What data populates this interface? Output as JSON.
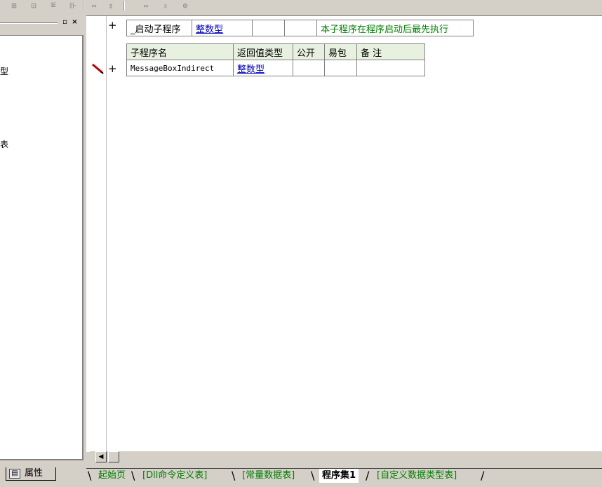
{
  "toolbar": {
    "icons": [
      "merge-cells-icon",
      "center-icon",
      "align-icon",
      "split-icon",
      "width-icon",
      "height-icon",
      "hspan-icon",
      "vspan-icon",
      "fit-icon"
    ]
  },
  "left_panel": {
    "tree_items": [
      "型",
      "表"
    ],
    "props_tab_label": "属性"
  },
  "editor": {
    "startup_row": {
      "name": "_启动子程序",
      "type": "整数型",
      "public": "",
      "easy": "",
      "comment": "本子程序在程序启动后最先执行"
    },
    "table_header": [
      "子程序名",
      "返回值类型",
      "公开",
      "易包",
      "备 注"
    ],
    "sub_row": {
      "name": "MessageBoxIndirect",
      "type": "整数型",
      "public": "",
      "easy": "",
      "comment": ""
    },
    "plus_symbol": "+"
  },
  "tabs": [
    {
      "label": "起始页",
      "active": false
    },
    {
      "label": "[Dll命令定义表]",
      "active": false
    },
    {
      "label": "[常量数据表]",
      "active": false
    },
    {
      "label": "程序集1",
      "active": true
    },
    {
      "label": "[自定义数据类型表]",
      "active": false
    }
  ]
}
